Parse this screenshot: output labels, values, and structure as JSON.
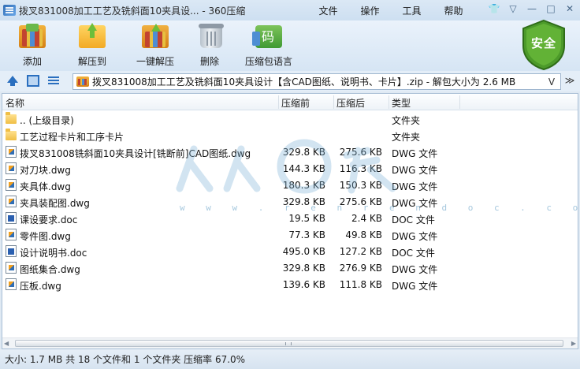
{
  "window": {
    "title": "拨叉831008加工工艺及铣斜面10夹具设... - 360压缩"
  },
  "menu": {
    "items": [
      "文件",
      "操作",
      "工具",
      "帮助"
    ]
  },
  "system_buttons": {
    "shirt": "👕",
    "dropdown": "▽",
    "minimize": "—",
    "maximize": "□",
    "close": "✕"
  },
  "toolbar": {
    "add_label": "添加",
    "extract_label": "解压到",
    "oneclick_label": "一键解压",
    "delete_label": "删除",
    "lang_label": "压缩包语言"
  },
  "security": {
    "label": "安全",
    "color": "#4c9a2a"
  },
  "address": {
    "path": "拨叉831008加工工艺及铣斜面10夹具设计【含CAD图纸、说明书、卡片】.zip - 解包大小为 2.6 MB",
    "dropdown": "V",
    "end_icon": "≫"
  },
  "columns": {
    "name": "名称",
    "size": "压缩前",
    "compressed": "压缩后",
    "type": "类型"
  },
  "files": [
    {
      "icon": "folder",
      "name": ".. (上级目录)",
      "size": "",
      "compressed": "",
      "type": "文件夹"
    },
    {
      "icon": "folder",
      "name": "工艺过程卡片和工序卡片",
      "size": "",
      "compressed": "",
      "type": "文件夹"
    },
    {
      "icon": "dwg",
      "name": "拨叉831008铣斜面10夹具设计[铣断前]CAD图纸.dwg",
      "size": "329.8 KB",
      "compressed": "275.6 KB",
      "type": "DWG 文件"
    },
    {
      "icon": "dwg",
      "name": "对刀块.dwg",
      "size": "144.3 KB",
      "compressed": "116.3 KB",
      "type": "DWG 文件"
    },
    {
      "icon": "dwg",
      "name": "夹具体.dwg",
      "size": "180.3 KB",
      "compressed": "150.3 KB",
      "type": "DWG 文件"
    },
    {
      "icon": "dwg",
      "name": "夹具装配图.dwg",
      "size": "329.8 KB",
      "compressed": "275.6 KB",
      "type": "DWG 文件"
    },
    {
      "icon": "doc",
      "name": "课设要求.doc",
      "size": "19.5 KB",
      "compressed": "2.4 KB",
      "type": "DOC 文件"
    },
    {
      "icon": "dwg",
      "name": "零件图.dwg",
      "size": "77.3 KB",
      "compressed": "49.8 KB",
      "type": "DWG 文件"
    },
    {
      "icon": "doc",
      "name": "设计说明书.doc",
      "size": "495.0 KB",
      "compressed": "127.2 KB",
      "type": "DOC 文件"
    },
    {
      "icon": "dwg",
      "name": "图纸集合.dwg",
      "size": "329.8 KB",
      "compressed": "276.9 KB",
      "type": "DWG 文件"
    },
    {
      "icon": "dwg",
      "name": "压板.dwg",
      "size": "139.6 KB",
      "compressed": "111.8 KB",
      "type": "DWG 文件"
    }
  ],
  "watermark": {
    "url_text": "w w w . r e n r e n d o c . c o m"
  },
  "scrollbar": {
    "left_arrow": "◀",
    "right_arrow": "▶"
  },
  "status": {
    "text": "大小: 1.7 MB 共 18 个文件和 1 个文件夹 压缩率 67.0%"
  }
}
